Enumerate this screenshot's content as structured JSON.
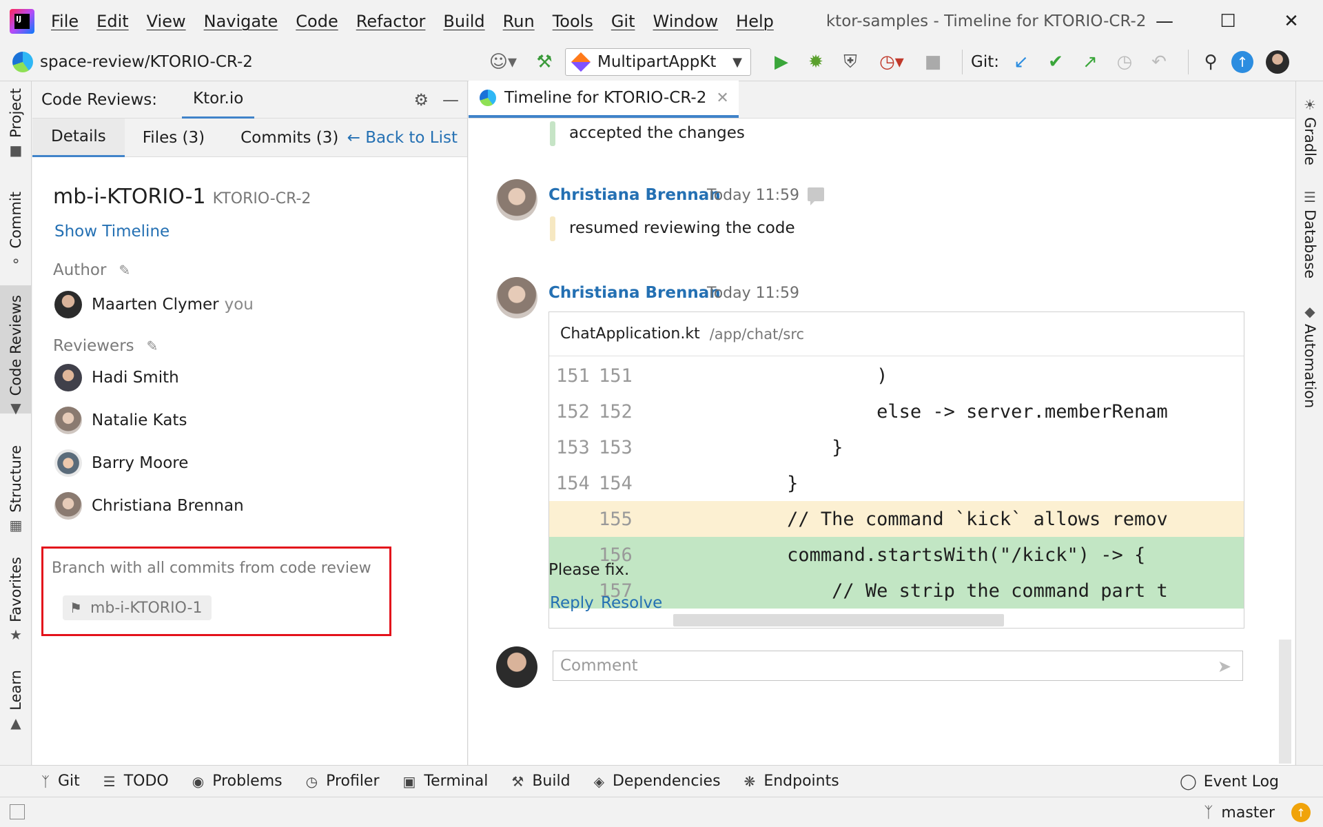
{
  "menu": {
    "items": [
      "File",
      "Edit",
      "View",
      "Navigate",
      "Code",
      "Refactor",
      "Build",
      "Run",
      "Tools",
      "Git",
      "Window",
      "Help"
    ],
    "window_title": "ktor-samples - Timeline for KTORIO-CR-2"
  },
  "toolbar": {
    "breadcrumb": "space-review/KTORIO-CR-2",
    "run_config": "MultipartAppKt",
    "git_label": "Git:"
  },
  "left_stripe": {
    "project": "Project",
    "commit": "Commit",
    "code_reviews": "Code Reviews",
    "structure": "Structure",
    "favorites": "Favorites",
    "learn": "Learn"
  },
  "right_stripe": {
    "gradle": "Gradle",
    "database": "Database",
    "automation": "Automation"
  },
  "code_reviews": {
    "title": "Code Reviews:",
    "tab": "Ktor.io",
    "subtabs": [
      "Details",
      "Files (3)",
      "Commits (3)"
    ],
    "back_link": "← Back to List",
    "review_name": "mb-i-KTORIO-1",
    "review_key": "KTORIO-CR-2",
    "show_timeline": "Show Timeline",
    "author_label": "Author",
    "author": {
      "name": "Maarten Clymer",
      "suffix": "you"
    },
    "reviewers_label": "Reviewers",
    "reviewers": [
      "Hadi Smith",
      "Natalie Kats",
      "Barry Moore",
      "Christiana Brennan"
    ],
    "branch_label": "Branch with all commits from code review",
    "branch": "mb-i-KTORIO-1"
  },
  "editor": {
    "tab_label": "Timeline for KTORIO-CR-2",
    "events": [
      {
        "text": "accepted the changes"
      },
      {
        "author": "Christiana Brennan",
        "time": "Today 11:59",
        "text": "resumed reviewing the code"
      },
      {
        "author": "Christiana Brennan",
        "time": "Today 11:59"
      }
    ],
    "code": {
      "file": "ChatApplication.kt",
      "path": "/app/chat/src",
      "lines": [
        {
          "old": "151",
          "new": "151",
          "src": "                    )"
        },
        {
          "old": "152",
          "new": "152",
          "src": "                    else -> server.memberRenam"
        },
        {
          "old": "153",
          "new": "153",
          "src": "                }"
        },
        {
          "old": "154",
          "new": "154",
          "src": "            }"
        },
        {
          "old": "",
          "new": "155",
          "src": "            // The command `kick` allows remov"
        },
        {
          "old": "",
          "new": "156",
          "src": "            command.startsWith(\"/kick\") -> {"
        },
        {
          "old": "",
          "new": "157",
          "src": "                // We strip the command part t"
        }
      ]
    },
    "comment_body": "Please fix.",
    "reply": "Reply",
    "resolve": "Resolve",
    "comment_placeholder": "Comment"
  },
  "bottom_bar": {
    "items": [
      "Git",
      "TODO",
      "Problems",
      "Profiler",
      "Terminal",
      "Build",
      "Dependencies",
      "Endpoints"
    ],
    "event_log": "Event Log"
  },
  "status": {
    "branch": "master"
  },
  "colors": {
    "accent": "#4083c9",
    "link": "#2470b3",
    "highlight_box": "#e3111b",
    "added_line": "#c2e6c4",
    "modified_line": "#fcf0d2"
  }
}
